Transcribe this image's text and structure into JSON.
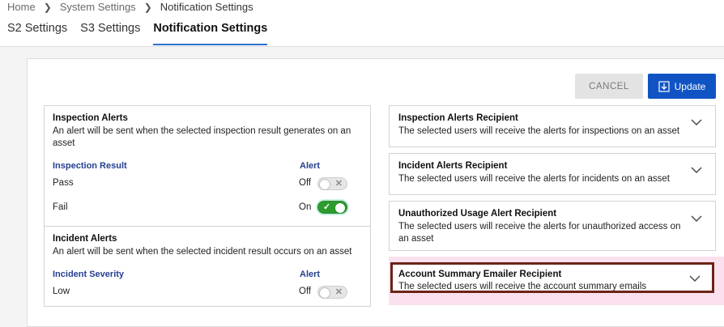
{
  "breadcrumb": {
    "home": "Home",
    "system": "System Settings",
    "current": "Notification Settings"
  },
  "tabs": [
    {
      "label": "S2 Settings"
    },
    {
      "label": "S3 Settings"
    },
    {
      "label": "Notification Settings"
    }
  ],
  "actions": {
    "cancel": "CANCEL",
    "update": "Update"
  },
  "inspection": {
    "title": "Inspection Alerts",
    "desc": "An alert will be sent when the selected inspection result generates on an asset",
    "col_left": "Inspection Result",
    "col_right": "Alert",
    "rows": [
      {
        "label": "Pass",
        "state": "Off"
      },
      {
        "label": "Fail",
        "state": "On"
      }
    ]
  },
  "incident": {
    "title": "Incident Alerts",
    "desc": "An alert will be sent when the selected incident result occurs on an asset",
    "col_left": "Incident Severity",
    "col_right": "Alert",
    "rows": [
      {
        "label": "Low",
        "state": "Off"
      }
    ]
  },
  "recipients": [
    {
      "title": "Inspection Alerts Recipient",
      "desc": "The selected users will receive the alerts for inspections on an asset"
    },
    {
      "title": "Incident Alerts Recipient",
      "desc": "The selected users will receive the alerts for incidents on an asset"
    },
    {
      "title": "Unauthorized Usage Alert Recipient",
      "desc": "The selected users will receive the alerts for unauthorized access on an asset"
    },
    {
      "title": "Account Summary Emailer Recipient",
      "desc": "The selected users will receive the account summary emails"
    }
  ],
  "colors": {
    "accent": "#1054c4",
    "toggle_on": "#2e9b2e",
    "highlight_border": "#6b2416",
    "highlight_bg": "#fbe1ee"
  }
}
